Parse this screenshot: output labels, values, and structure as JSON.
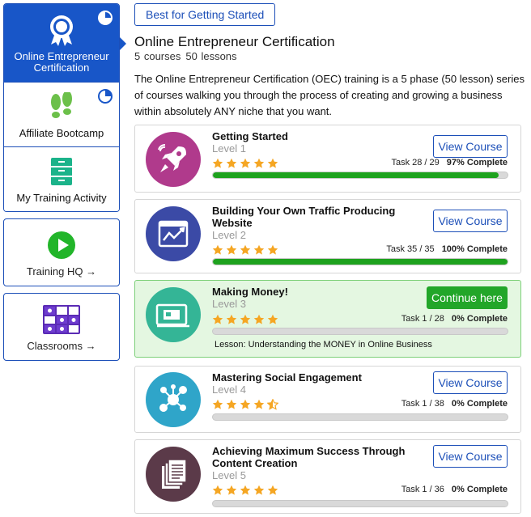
{
  "sidebar": {
    "items": [
      {
        "label_line1": "Online Entrepreneur",
        "label_line2": "Certification",
        "icon": "ribbon-award-icon",
        "progress": 0.25
      },
      {
        "label": "Affiliate Bootcamp",
        "icon": "footprints-icon",
        "progress": 0.25
      },
      {
        "label": "My Training Activity",
        "icon": "cabinet-icon"
      }
    ],
    "training_hq": {
      "label": "Training HQ →",
      "icon": "play-circle-icon"
    },
    "classrooms": {
      "label": "Classrooms →",
      "icon": "grid-blocks-icon"
    }
  },
  "filter_button": "Best for Getting Started",
  "header": {
    "title": "Online Entrepreneur Certification",
    "courses": "5 courses",
    "lessons": "50 lessons",
    "description": "The Online Entrepreneur Certification (OEC) training is a 5 phase (50 lesson) series of courses walking you through the process of creating and growing a business within absolutely ANY niche that you want."
  },
  "courses": [
    {
      "title": "Getting Started",
      "level": "Level 1",
      "rating": 5,
      "task": "Task 28 / 29",
      "complete": "97% Complete",
      "progress": 0.97,
      "button": "View Course",
      "icon": "rocket-icon",
      "icon_color": "#b03a8c"
    },
    {
      "title": "Building Your Own Traffic Producing Website",
      "level": "Level 2",
      "rating": 5,
      "task": "Task 35 / 35",
      "complete": "100% Complete",
      "progress": 1.0,
      "button": "View Course",
      "icon": "website-chart-icon",
      "icon_color": "#3b4aa6"
    },
    {
      "title": "Making Money!",
      "level": "Level 3",
      "rating": 5,
      "task": "Task 1 / 28",
      "complete": "0% Complete",
      "progress": 0.0,
      "button": "Continue here",
      "lesson": "Lesson: Understanding the MONEY in Online Business",
      "icon": "credit-card-icon",
      "icon_color": "#34b596"
    },
    {
      "title": "Mastering Social Engagement",
      "level": "Level 4",
      "rating": 4.5,
      "task": "Task 1 / 38",
      "complete": "0% Complete",
      "progress": 0.0,
      "button": "View Course",
      "icon": "social-network-icon",
      "icon_color": "#2fa5c9"
    },
    {
      "title": "Achieving Maximum Success Through Content Creation",
      "level": "Level 5",
      "rating": 5,
      "task": "Task 1 / 36",
      "complete": "0% Complete",
      "progress": 0.0,
      "button": "View Course",
      "icon": "documents-icon",
      "icon_color": "#5b3a49"
    }
  ]
}
